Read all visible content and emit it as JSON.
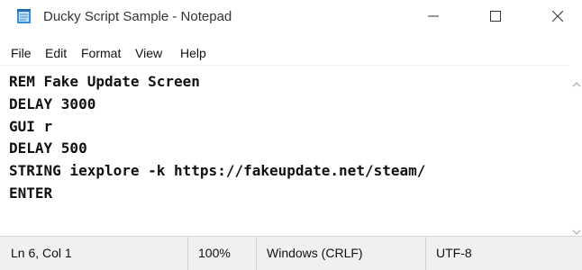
{
  "window": {
    "title": "Ducky Script Sample - Notepad",
    "icon": "notepad-icon",
    "controls": [
      "minimize-icon",
      "maximize-icon",
      "close-icon"
    ]
  },
  "menu": {
    "items": [
      "File",
      "Edit",
      "Format",
      "View",
      "Help"
    ]
  },
  "editor": {
    "lines": [
      "REM Fake Update Screen",
      "DELAY 3000",
      "GUI r",
      "DELAY 500",
      "STRING iexplore -k https://fakeupdate.net/steam/",
      "ENTER"
    ]
  },
  "status": {
    "position": "Ln 6, Col 1",
    "zoom": "100%",
    "line_ending": "Windows (CRLF)",
    "encoding": "UTF-8"
  }
}
